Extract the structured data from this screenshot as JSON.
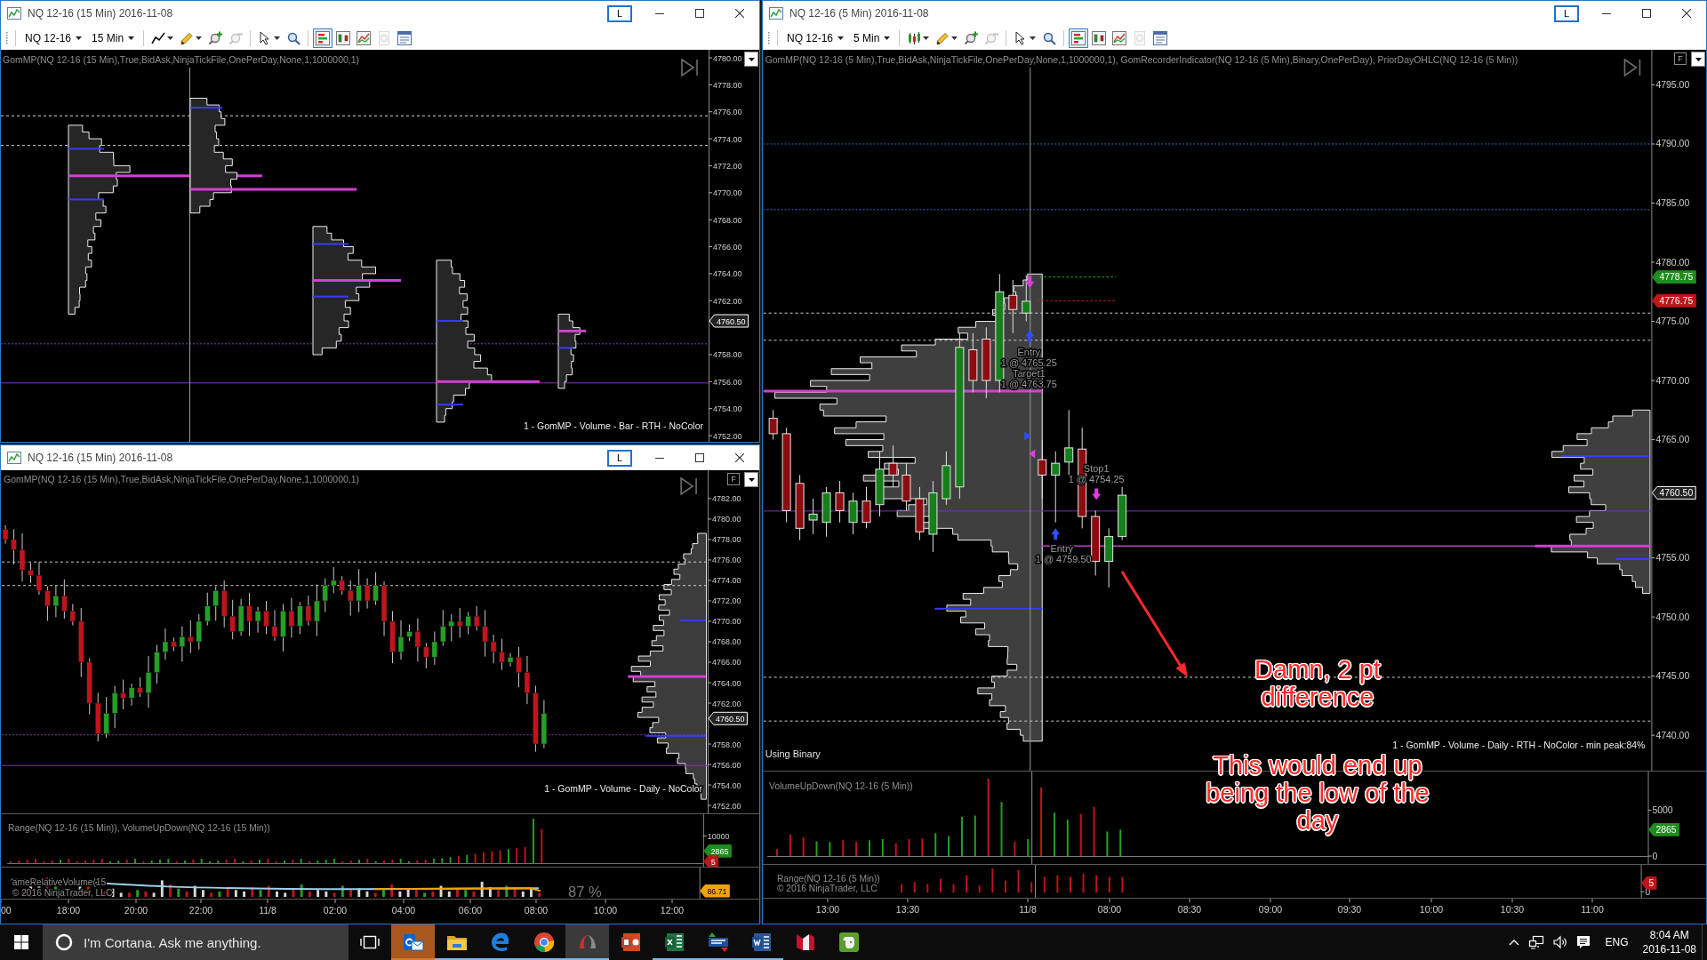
{
  "top_left_window": {
    "title": "NQ 12-16 (15 Min) 2016-11-08",
    "layout_button": "L",
    "toolbar": {
      "instrument": "NQ 12-16",
      "interval": "15 Min",
      "tool_groups": [
        [
          {
            "kind": "line",
            "menu": true,
            "selected": false,
            "disabled": false
          },
          {
            "kind": "pencil",
            "menu": true,
            "selected": false,
            "disabled": false
          },
          {
            "kind": "zoom-in",
            "menu": false,
            "selected": false,
            "disabled": false
          },
          {
            "kind": "zoom-out",
            "menu": false,
            "selected": false,
            "disabled": true
          }
        ],
        [
          {
            "kind": "cursor",
            "menu": true,
            "selected": false,
            "disabled": false
          },
          {
            "kind": "find",
            "menu": false,
            "selected": false,
            "disabled": false
          }
        ],
        [
          {
            "kind": "data-box",
            "menu": false,
            "selected": true,
            "disabled": false
          },
          {
            "kind": "bar-style",
            "menu": false,
            "selected": false,
            "disabled": false
          },
          {
            "kind": "indicators",
            "menu": false,
            "selected": false,
            "disabled": false
          },
          {
            "kind": "strategies",
            "menu": false,
            "selected": false,
            "disabled": true
          },
          {
            "kind": "properties",
            "menu": false,
            "selected": false,
            "disabled": false
          }
        ]
      ]
    },
    "chart": {
      "indicator_label": "GomMP(NQ 12-16 (15 Min),True,BidAsk,NinjaTickFile,OnePerDay,None,1,1000000,1)",
      "price_axis": [
        "4780.00",
        "4778.00",
        "4776.00",
        "4774.00",
        "4772.00",
        "4770.00",
        "4768.00",
        "4766.00",
        "4764.00",
        "4762.00",
        "4758.00",
        "4756.00",
        "4754.00",
        "4752.00"
      ],
      "price_markers": [
        {
          "text": "4760.50",
          "color": "#222222"
        }
      ],
      "profile_caption": "1 - GomMP - Volume - Bar - RTH - NoColor"
    }
  },
  "bottom_left_window": {
    "title": "NQ 12-16 (15 Min) 2016-11-08",
    "layout_button": "L",
    "chart": {
      "indicator_label": "GomMP(NQ 12-16 (15 Min),True,BidAsk,NinjaTickFile,OnePerDay,None,1,1000000,1)",
      "f_button": "F",
      "price_axis": [
        "4782.00",
        "4780.00",
        "4778.00",
        "4776.00",
        "4774.00",
        "4772.00",
        "4770.00",
        "4768.00",
        "4766.00",
        "4764.00",
        "4762.00",
        "4758.00",
        "4756.00",
        "4754.00",
        "4752.00"
      ],
      "price_markers": [
        {
          "text": "4760.50",
          "color": "#222222"
        }
      ],
      "profile_caption": "1 - GomMP - Volume - Daily - NoColor"
    },
    "volume_panel": {
      "label": "Range(NQ 12-16 (15 Min)), VolumeUpDown(NQ 12-16 (15 Min))",
      "axis": [
        "10000"
      ],
      "markers": [
        {
          "text": "2865",
          "color": "#1e8c1e"
        },
        {
          "text": "5",
          "color": "#c0151a"
        }
      ]
    },
    "relative_volume_panel": {
      "label": "ameRelativeVolume(15",
      "copyright": "© 2016 NinjaTrader, LLC",
      "reading": "87 %",
      "markers": [
        {
          "text": "86.71",
          "color": "#f0a30a"
        }
      ]
    },
    "time_axis": [
      "00",
      "18:00",
      "20:00",
      "22:00",
      "11/8",
      "02:00",
      "04:00",
      "06:00",
      "08:00",
      "10:00",
      "12:00"
    ]
  },
  "right_window": {
    "title": "NQ 12-16 (5 Min) 2016-11-08",
    "layout_button": "L",
    "toolbar": {
      "instrument": "NQ 12-16",
      "interval": "5 Min",
      "tool_groups": [
        [
          {
            "kind": "candles",
            "menu": true,
            "selected": false,
            "disabled": false
          },
          {
            "kind": "pencil",
            "menu": true,
            "selected": false,
            "disabled": false
          },
          {
            "kind": "zoom-in",
            "menu": false,
            "selected": false,
            "disabled": false
          },
          {
            "kind": "zoom-out",
            "menu": false,
            "selected": false,
            "disabled": true
          }
        ],
        [
          {
            "kind": "cursor",
            "menu": true,
            "selected": false,
            "disabled": false
          },
          {
            "kind": "find",
            "menu": false,
            "selected": false,
            "disabled": false
          }
        ],
        [
          {
            "kind": "data-box",
            "menu": false,
            "selected": true,
            "disabled": false
          },
          {
            "kind": "bar-style",
            "menu": false,
            "selected": false,
            "disabled": false
          },
          {
            "kind": "indicators",
            "menu": false,
            "selected": false,
            "disabled": false
          },
          {
            "kind": "strategies",
            "menu": false,
            "selected": false,
            "disabled": true
          },
          {
            "kind": "properties",
            "menu": false,
            "selected": false,
            "disabled": false
          }
        ]
      ]
    },
    "chart": {
      "indicator_label": "GomMP(NQ 12-16 (5 Min),True,BidAsk,NinjaTickFile,OnePerDay,None,1,1000000,1), GomRecorderIndicator(NQ 12-16 (5 Min),Binary,OnePerDay), PriorDayOHLC(NQ 12-16 (5 Min))",
      "f_button": "F",
      "price_axis": [
        "4795.00",
        "4790.00",
        "4785.00",
        "4780.00",
        "4775.00",
        "4770.00",
        "4765.00",
        "4755.00",
        "4750.00",
        "4745.00",
        "4740.00"
      ],
      "price_markers": [
        {
          "text": "4778.75",
          "color": "#1e8c1e"
        },
        {
          "text": "4776.75",
          "color": "#c0151a"
        },
        {
          "text": "4760.50",
          "color": "#222222"
        }
      ],
      "order_labels": [
        "Entry",
        "1 @ 4765.25",
        "Target1",
        "1 @ 4763.75",
        "Stop1",
        "1 @ 4754.25",
        "Entry",
        "1 @ 4759.50"
      ],
      "status_text": "Using Binary",
      "profile_caption": "1 - GomMP - Volume - Daily - RTH - NoColor - min peak:84%"
    },
    "volume_panel": {
      "label": "VolumeUpDown(NQ 12-16 (5 Min))",
      "axis": [
        "5000",
        "0"
      ],
      "markers": [
        {
          "text": "2865",
          "color": "#1e8c1e"
        }
      ]
    },
    "range_panel": {
      "label": "Range(NQ 12-16 (5 Min))",
      "copyright": "© 2016 NinjaTrader, LLC",
      "axis": [
        "0"
      ],
      "markers": [
        {
          "text": "5",
          "color": "#c0151a"
        }
      ]
    },
    "time_axis": [
      "13:00",
      "13:30",
      "11/8",
      "08:00",
      "08:30",
      "09:00",
      "09:30",
      "10:00",
      "10:30",
      "11:00"
    ]
  },
  "annotations": [
    {
      "text": "Damn, 2 pt difference"
    },
    {
      "text": "This would end up being the low of the day"
    }
  ],
  "taskbar": {
    "search": {
      "placeholder": "I'm Cortana. Ask me anything."
    },
    "apps": [
      {
        "kind": "mail",
        "running": true,
        "selected": false,
        "flashing": true
      },
      {
        "kind": "folder",
        "running": true,
        "selected": false,
        "flashing": false
      },
      {
        "kind": "web",
        "running": true,
        "selected": false,
        "flashing": false
      },
      {
        "kind": "globe",
        "running": true,
        "selected": false,
        "flashing": false
      },
      {
        "kind": "trading",
        "running": true,
        "selected": true,
        "flashing": false
      },
      {
        "kind": "slides",
        "running": false,
        "selected": false,
        "flashing": false
      },
      {
        "kind": "sheet",
        "running": true,
        "selected": false,
        "flashing": false
      },
      {
        "kind": "tws",
        "running": true,
        "selected": false,
        "flashing": false
      },
      {
        "kind": "document",
        "running": true,
        "selected": false,
        "flashing": false
      },
      {
        "kind": "mcard",
        "running": false,
        "selected": false,
        "flashing": false
      },
      {
        "kind": "notes",
        "running": false,
        "selected": false,
        "flashing": false
      }
    ],
    "language": "ENG",
    "time": "8:04 AM",
    "date": "2016-11-08"
  }
}
